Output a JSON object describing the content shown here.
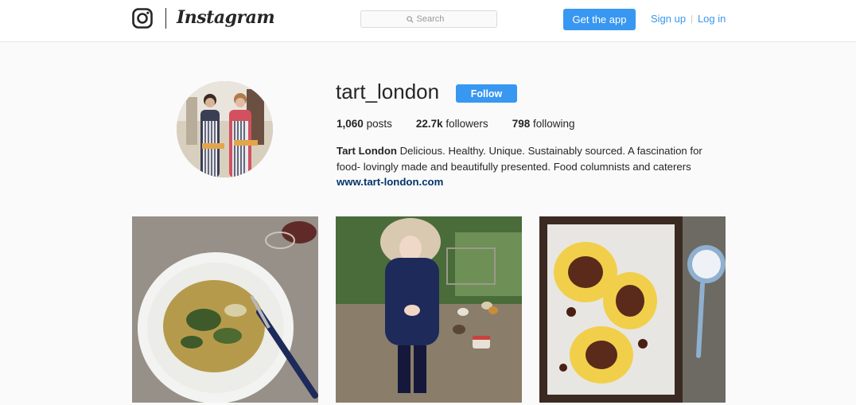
{
  "header": {
    "wordmark": "Instagram",
    "search": {
      "placeholder": "Search"
    },
    "get_app_label": "Get the app",
    "signup_label": "Sign up",
    "separator": "|",
    "login_label": "Log in",
    "icons": [
      "instagram-camera-icon",
      "search-icon"
    ]
  },
  "profile": {
    "username": "tart_london",
    "follow_label": "Follow",
    "posts_count": "1,060",
    "posts_label": "posts",
    "followers_count": "22.7k",
    "followers_label": "followers",
    "following_count": "798",
    "following_label": "following",
    "full_name": "Tart London",
    "bio": "Delicious. Healthy. Unique. Sustainably sourced. A fascination for food- lovingly made and beautifully presented. Food columnists and caterers",
    "website": "www.tart-london.com"
  },
  "colors": {
    "accent": "#3897f0",
    "link": "#003569",
    "background": "#fafafa"
  }
}
